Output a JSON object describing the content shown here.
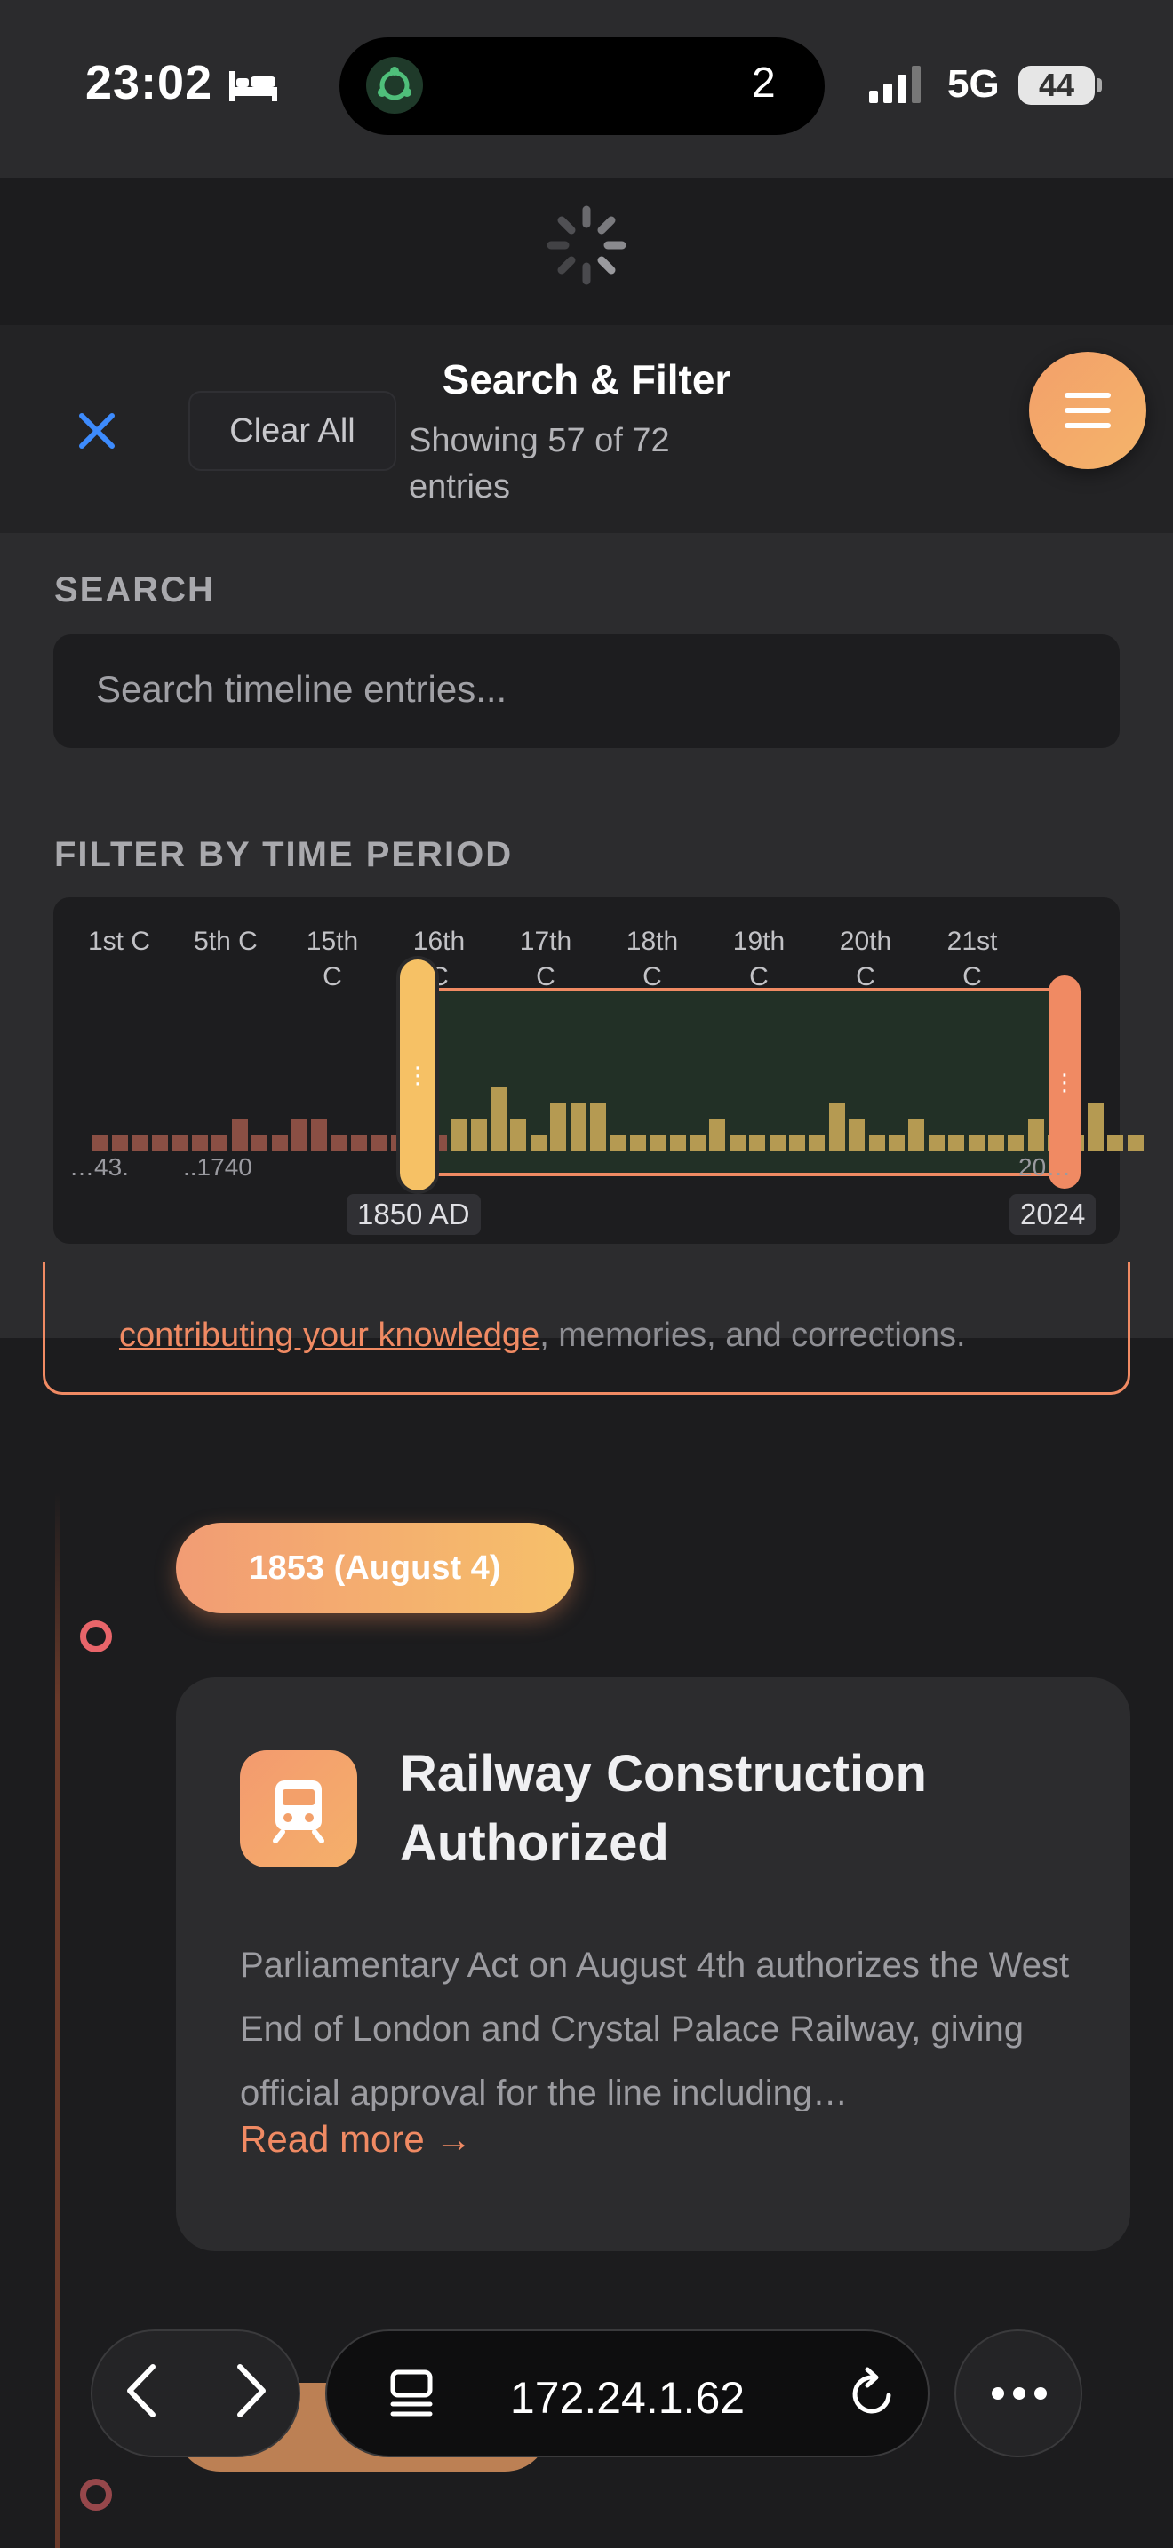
{
  "status_bar": {
    "time": "23:02",
    "activity_count": "2",
    "network": "5G",
    "battery": "44"
  },
  "filter_header": {
    "title": "Search & Filter",
    "subtitle_line1": "Showing 57 of 72",
    "subtitle_line2": "entries",
    "clear_all": "Clear All"
  },
  "search": {
    "label": "SEARCH",
    "placeholder": "Search timeline entries..."
  },
  "time_filter": {
    "label": "FILTER BY TIME PERIOD",
    "centuries": [
      {
        "line1": "1st C",
        "line2": ""
      },
      {
        "line1": "5th C",
        "line2": ""
      },
      {
        "line1": "15th",
        "line2": "C"
      },
      {
        "line1": "16th",
        "line2": "C"
      },
      {
        "line1": "17th",
        "line2": "C"
      },
      {
        "line1": "18th",
        "line2": "C"
      },
      {
        "line1": "19th",
        "line2": "C"
      },
      {
        "line1": "20th",
        "line2": "C"
      },
      {
        "line1": "21st",
        "line2": "C"
      }
    ],
    "start_value": "1850 AD",
    "end_value": "2024",
    "axis_ticks": [
      "…43.",
      "..1740",
      "20…"
    ],
    "histogram": [
      1,
      1,
      1,
      1,
      1,
      1,
      1,
      2,
      1,
      1,
      2,
      2,
      1,
      1,
      1,
      1,
      1,
      1,
      2,
      2,
      4,
      2,
      1,
      3,
      3,
      3,
      1,
      1,
      1,
      1,
      1,
      2,
      1,
      1,
      1,
      1,
      1,
      3,
      2,
      1,
      1,
      2,
      1,
      1,
      1,
      1,
      1,
      2,
      1,
      1,
      3,
      1,
      1
    ]
  },
  "notice": {
    "link": "contributing your knowledge",
    "rest": ", memories, and corrections."
  },
  "timeline_entry": {
    "date": "1853 (August 4)",
    "title_line1": "Railway Construction",
    "title_line2": "Authorized",
    "body": "Parliamentary Act on August 4th authorizes the West End of London and Crystal Palace Railway, giving official approval for the line including…",
    "read_more": "Read more →"
  },
  "browser": {
    "url": "172.24.1.62"
  },
  "colors": {
    "accent": "#f08a63",
    "accent_gold": "#f6c165",
    "bar_in_range": "#b59a52",
    "bar_out_range": "#8a4f44"
  }
}
